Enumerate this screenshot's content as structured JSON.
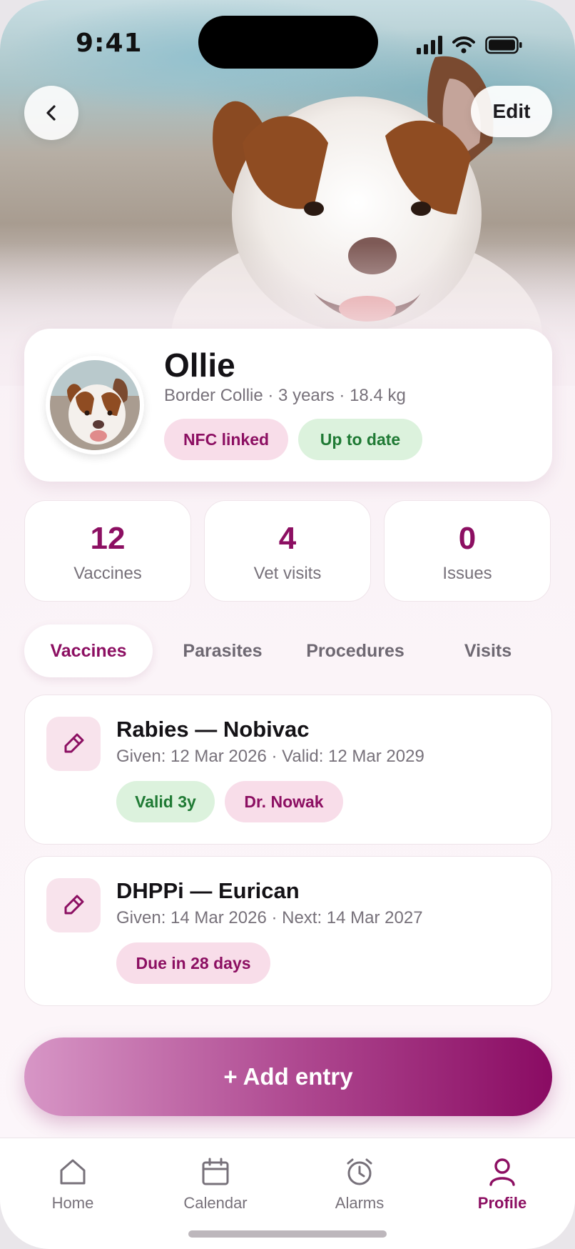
{
  "status_bar": {
    "time": "9:41"
  },
  "header": {
    "back_icon": "chevron-left-icon",
    "edit_label": "Edit"
  },
  "pet": {
    "name": "Ollie",
    "meta": "Border Collie · 3 years · 18.4 kg",
    "badges": [
      {
        "label": "NFC linked",
        "tone": "pink"
      },
      {
        "label": "Up to date",
        "tone": "green"
      }
    ]
  },
  "stats": [
    {
      "value": "12",
      "label": "Vaccines"
    },
    {
      "value": "4",
      "label": "Vet visits"
    },
    {
      "value": "0",
      "label": "Issues"
    }
  ],
  "tabs": [
    {
      "label": "Vaccines",
      "active": true
    },
    {
      "label": "Parasites",
      "active": false
    },
    {
      "label": "Procedures",
      "active": false
    },
    {
      "label": "Visits",
      "active": false
    }
  ],
  "entries": [
    {
      "icon": "syringe-icon",
      "title": "Rabies — Nobivac",
      "subtitle": "Given: 12 Mar 2026 · Valid: 12 Mar 2029",
      "badges": [
        {
          "label": "Valid 3y",
          "tone": "green"
        },
        {
          "label": "Dr. Nowak",
          "tone": "pink"
        }
      ]
    },
    {
      "icon": "syringe-icon",
      "title": "DHPPi — Eurican",
      "subtitle": "Given: 14 Mar 2026 · Next: 14 Mar 2027",
      "badges": [
        {
          "label": "Due in 28 days",
          "tone": "pink"
        }
      ]
    }
  ],
  "add_button": {
    "label": "+ Add entry"
  },
  "nav": [
    {
      "label": "Home",
      "icon": "home-icon",
      "active": false
    },
    {
      "label": "Calendar",
      "icon": "calendar-icon",
      "active": false
    },
    {
      "label": "Alarms",
      "icon": "alarm-clock-icon",
      "active": false
    },
    {
      "label": "Profile",
      "icon": "profile-icon",
      "active": true
    }
  ],
  "colors": {
    "accent": "#8c0f62",
    "accent_light": "#f8dde9",
    "success": "#1f7a34",
    "success_light": "#dcf2dd"
  }
}
